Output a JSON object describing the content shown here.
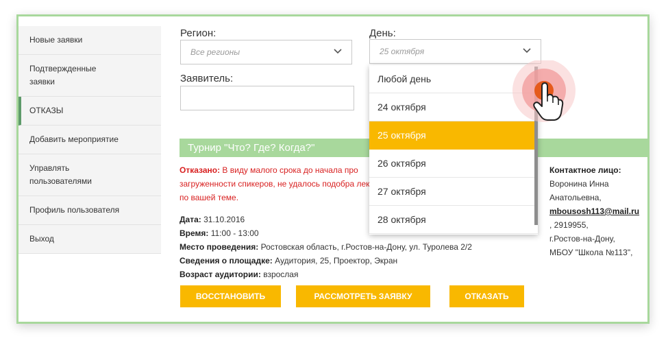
{
  "sidebar": {
    "items": [
      {
        "label": "Новые заявки"
      },
      {
        "label": "Подтвержденные заявки"
      },
      {
        "label": "ОТКАЗЫ"
      },
      {
        "label": "Добавить мероприятие"
      },
      {
        "label": "Управлять пользователями"
      },
      {
        "label": "Профиль пользователя"
      },
      {
        "label": "Выход"
      }
    ],
    "active": "ОТКАЗЫ"
  },
  "filters": {
    "region_label": "Регион:",
    "region_placeholder": "Все регионы",
    "day_label": "День:",
    "day_value": "25 октября",
    "applicant_label": "Заявитель:",
    "applicant_value": ""
  },
  "day_dropdown": {
    "options": [
      "Любой день",
      "24 октября",
      "25 октября",
      "26 октября",
      "27 октября",
      "28 октября"
    ],
    "selected": "25 октября"
  },
  "event": {
    "title": "Турнир \"Что? Где? Когда?\"",
    "refusal_label": "Отказано:",
    "refusal_text": " В виду малого срока до начала про загруженности спикеров, не удалось подобра лекции по вашей теме.",
    "date_label": "Дата:",
    "date": " 31.10.2016",
    "time_label": "Время:",
    "time": " 11:00 - 13:00",
    "place_label": "Место проведения:",
    "place": " Ростовская область, г.Ростов-на-Дону, ул. Туролева 2/2",
    "venue_label": "Сведения о площадке:",
    "venue": " Аудитория, 25, Проектор, Экран",
    "age_label": "Возраст аудитории:",
    "age": " взрослая"
  },
  "contact": {
    "heading": "Контактное лицо:",
    "name_line1": "Воронина Инна",
    "name_line2": "Анатольевна,",
    "email": "mbousosh113@mail.ru",
    "phone": ", 2919955,",
    "city": "г.Ростов-на-Дону,",
    "org": "МБОУ \"Школа №113\","
  },
  "actions": {
    "restore": "ВОССТАНОВИТЬ",
    "review": "РАССМОТРЕТЬ ЗАЯВКУ",
    "reject": "ОТКАЗАТЬ"
  },
  "colors": {
    "accent": "#f9b800",
    "green": "#a8d89c",
    "danger": "#d82020"
  }
}
